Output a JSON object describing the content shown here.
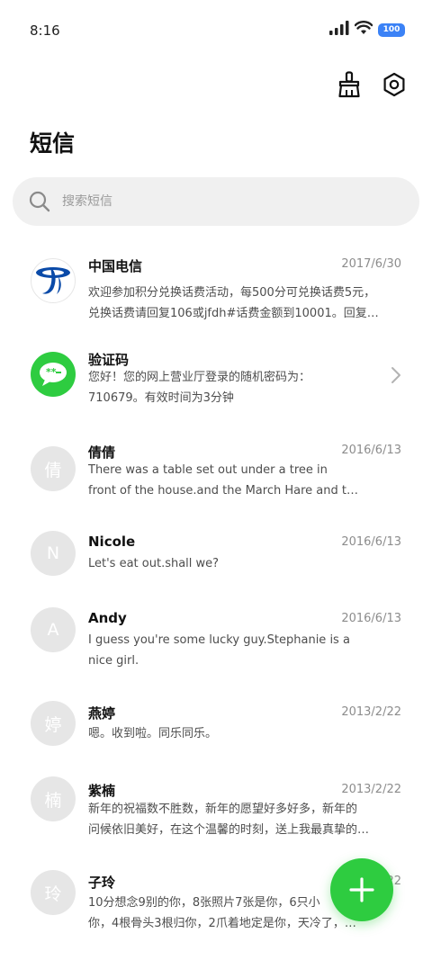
{
  "status_bar": {
    "time": "8:16",
    "battery": "100"
  },
  "header": {
    "title": "短信"
  },
  "search": {
    "placeholder": "搜索短信"
  },
  "conversations": [
    {
      "name": "中国电信",
      "date": "2017/6/30",
      "avatar_text": "",
      "avatar_type": "telecom-logo",
      "line1": "欢迎参加积分兑换话费活动，每500分可兑换话费5元，",
      "line2": "兑换话费请回复106或jfdh#话费金额到10001。回复…"
    },
    {
      "name": "验证码",
      "date": "",
      "avatar_type": "chat-bubble",
      "line1": "您好！您的网上营业厅登录的随机密码为：",
      "line2": "710679。有效时间为3分钟"
    },
    {
      "name": "倩倩",
      "date": "2016/6/13",
      "avatar_text": "倩",
      "line1": "There was a table set out under a tree in",
      "line2": "front of the house.and the March Hare and t…"
    },
    {
      "name": "Nicole",
      "date": "2016/6/13",
      "avatar_text": "N",
      "line1": "Let's eat out.shall we?",
      "line2": ""
    },
    {
      "name": "Andy",
      "date": "2016/6/13",
      "avatar_text": "A",
      "line1": "I guess you're some lucky guy.Stephanie is a",
      "line2": "nice girl."
    },
    {
      "name": "燕婷",
      "date": "2013/2/22",
      "avatar_text": "婷",
      "line1": "嗯。收到啦。同乐同乐。",
      "line2": ""
    },
    {
      "name": "紫楠",
      "date": "2013/2/22",
      "avatar_text": "楠",
      "line1": "新年的祝福数不胜数，新年的愿望好多好多，新年的",
      "line2": "问候依旧美好，在这个温馨的时刻，送上我最真挚的…"
    },
    {
      "name": "子玲",
      "date": "2013/2/22",
      "avatar_text": "玲",
      "line1": "10分想念9别的你，8张照片7张是你，6只小",
      "line2": "你，4根骨头3根归你，2爪着地定是你，天冷了，…"
    }
  ],
  "colors": {
    "accent": "#2ecc40",
    "telecom_blue": "#0a4aa8",
    "battery": "#3b82f6"
  }
}
